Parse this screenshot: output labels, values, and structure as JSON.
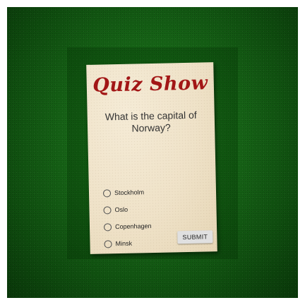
{
  "game": {
    "title": "Quiz Show",
    "question": "What is the capital of Norway?",
    "options": [
      {
        "label": "Stockholm",
        "selected": false
      },
      {
        "label": "Oslo",
        "selected": false
      },
      {
        "label": "Copenhagen",
        "selected": false
      },
      {
        "label": "Minsk",
        "selected": false
      }
    ],
    "submit_label": "SUBMIT"
  },
  "colors": {
    "table_felt": "#176617",
    "card_paper": "#efe2c8",
    "title_red": "#a21616",
    "button_gray": "#e0e0e0"
  }
}
